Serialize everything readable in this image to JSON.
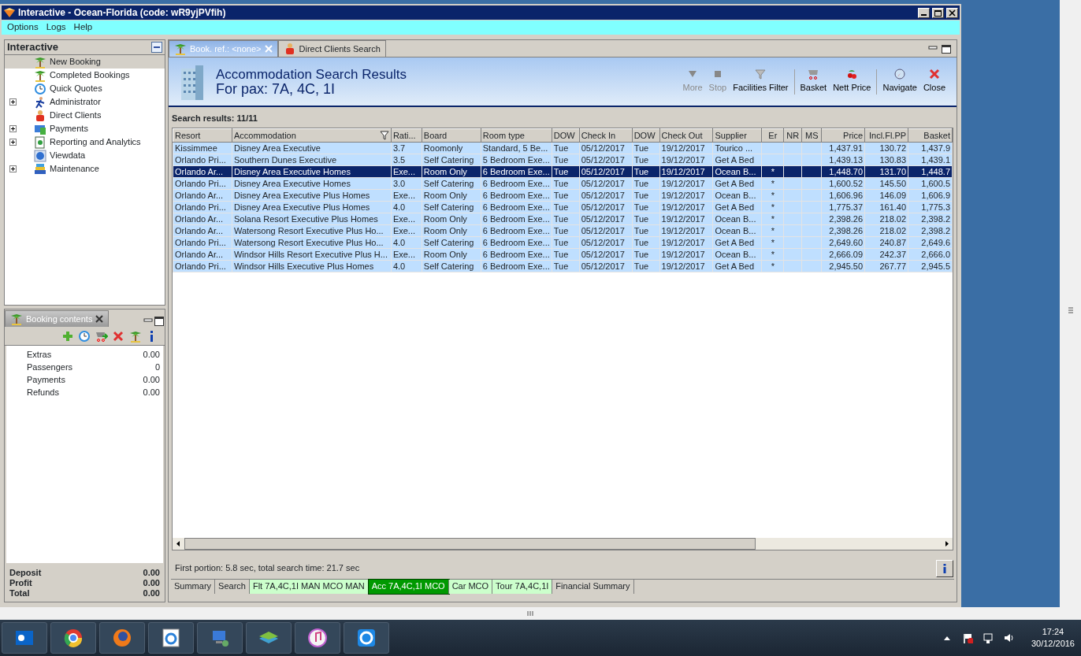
{
  "window": {
    "title": "Interactive - Ocean-Florida (code: wR9yjPVfih)"
  },
  "menu": [
    "Options",
    "Logs",
    "Help"
  ],
  "navigator": {
    "title": "Interactive",
    "items": [
      {
        "label": "New Booking",
        "selected": true,
        "expandable": false
      },
      {
        "label": "Completed Bookings",
        "selected": false,
        "expandable": false
      },
      {
        "label": "Quick Quotes",
        "selected": false,
        "expandable": false
      },
      {
        "label": "Administrator",
        "selected": false,
        "expandable": true
      },
      {
        "label": "Direct Clients",
        "selected": false,
        "expandable": false
      },
      {
        "label": "Payments",
        "selected": false,
        "expandable": true
      },
      {
        "label": "Reporting and Analytics",
        "selected": false,
        "expandable": true
      },
      {
        "label": "Viewdata",
        "selected": false,
        "expandable": false
      },
      {
        "label": "Maintenance",
        "selected": false,
        "expandable": true
      }
    ]
  },
  "booking_contents": {
    "tab": "Booking contents",
    "items": [
      {
        "label": "Extras",
        "value": "0.00"
      },
      {
        "label": "Passengers",
        "value": "0"
      },
      {
        "label": "Payments",
        "value": "0.00"
      },
      {
        "label": "Refunds",
        "value": "0.00"
      }
    ],
    "totals": [
      {
        "label": "Deposit",
        "value": "0.00"
      },
      {
        "label": "Profit",
        "value": "0.00"
      },
      {
        "label": "Total",
        "value": "0.00"
      }
    ]
  },
  "editor_tabs": [
    {
      "label": "Book. ref.: <none>",
      "selected": true,
      "closable": true
    },
    {
      "label": "Direct Clients Search",
      "selected": false,
      "closable": false
    }
  ],
  "header": {
    "title": "Accommodation Search Results",
    "subtitle": "For pax: 7A, 4C, 1I"
  },
  "toolbar": [
    [
      {
        "label": "More",
        "disabled": true
      },
      {
        "label": "Stop",
        "disabled": true
      },
      {
        "label": "Facilities Filter",
        "disabled": false
      }
    ],
    [
      {
        "label": "Basket",
        "disabled": false
      },
      {
        "label": "Nett Price",
        "disabled": false
      }
    ],
    [
      {
        "label": "Navigate",
        "disabled": false
      },
      {
        "label": "Close",
        "disabled": false
      }
    ]
  ],
  "results_label": "Search results: 11/11",
  "table": {
    "columns": [
      {
        "label": "Resort",
        "filter": false,
        "kind": "text"
      },
      {
        "label": "Accommodation",
        "filter": true,
        "kind": "text"
      },
      {
        "label": "Rati...",
        "filter": false,
        "kind": "text"
      },
      {
        "label": "Board",
        "filter": false,
        "kind": "text"
      },
      {
        "label": "Room type",
        "filter": false,
        "kind": "text"
      },
      {
        "label": "DOW",
        "filter": false,
        "kind": "text"
      },
      {
        "label": "Check In",
        "filter": false,
        "kind": "text"
      },
      {
        "label": "DOW",
        "filter": false,
        "kind": "text"
      },
      {
        "label": "Check Out",
        "filter": false,
        "kind": "text"
      },
      {
        "label": "Supplier",
        "filter": false,
        "kind": "text"
      },
      {
        "label": "Er",
        "filter": false,
        "kind": "flag"
      },
      {
        "label": "NR",
        "filter": false,
        "kind": "flag"
      },
      {
        "label": "MS",
        "filter": false,
        "kind": "flag"
      },
      {
        "label": "Price",
        "filter": false,
        "kind": "number"
      },
      {
        "label": "Incl.Fl.PP",
        "filter": false,
        "kind": "number"
      },
      {
        "label": "Basket",
        "filter": false,
        "kind": "number"
      }
    ],
    "rows": [
      {
        "selected": false,
        "cells": [
          "Kissimmee",
          "Disney Area Executive",
          "3.7",
          "Roomonly",
          "Standard, 5 Be...",
          "Tue",
          "05/12/2017",
          "Tue",
          "19/12/2017",
          "Tourico ...",
          null,
          null,
          null,
          "1,437.91",
          "130.72",
          "1,437.9"
        ]
      },
      {
        "selected": false,
        "cells": [
          "Orlando Pri...",
          "Southern Dunes Executive",
          "3.5",
          "Self Catering",
          "5 Bedroom Exe...",
          "Tue",
          "05/12/2017",
          "Tue",
          "19/12/2017",
          "Get A Bed",
          null,
          null,
          null,
          "1,439.13",
          "130.83",
          "1,439.1"
        ]
      },
      {
        "selected": true,
        "cells": [
          "Orlando Ar...",
          "Disney Area Executive Homes",
          "Exe...",
          "Room Only",
          "6 Bedroom Exe...",
          "Tue",
          "05/12/2017",
          "Tue",
          "19/12/2017",
          "Ocean B...",
          "*",
          null,
          null,
          "1,448.70",
          "131.70",
          "1,448.7"
        ]
      },
      {
        "selected": false,
        "cells": [
          "Orlando Pri...",
          "Disney Area Executive Homes",
          "3.0",
          "Self Catering",
          "6 Bedroom Exe...",
          "Tue",
          "05/12/2017",
          "Tue",
          "19/12/2017",
          "Get A Bed",
          "*",
          null,
          null,
          "1,600.52",
          "145.50",
          "1,600.5"
        ]
      },
      {
        "selected": false,
        "cells": [
          "Orlando Ar...",
          "Disney Area Executive Plus Homes",
          "Exe...",
          "Room Only",
          "6 Bedroom Exe...",
          "Tue",
          "05/12/2017",
          "Tue",
          "19/12/2017",
          "Ocean B...",
          "*",
          null,
          null,
          "1,606.96",
          "146.09",
          "1,606.9"
        ]
      },
      {
        "selected": false,
        "cells": [
          "Orlando Pri...",
          "Disney Area Executive Plus Homes",
          "4.0",
          "Self Catering",
          "6 Bedroom Exe...",
          "Tue",
          "05/12/2017",
          "Tue",
          "19/12/2017",
          "Get A Bed",
          "*",
          null,
          null,
          "1,775.37",
          "161.40",
          "1,775.3"
        ]
      },
      {
        "selected": false,
        "cells": [
          "Orlando Ar...",
          "Solana Resort Executive Plus Homes",
          "Exe...",
          "Room Only",
          "6 Bedroom Exe...",
          "Tue",
          "05/12/2017",
          "Tue",
          "19/12/2017",
          "Ocean B...",
          "*",
          null,
          null,
          "2,398.26",
          "218.02",
          "2,398.2"
        ]
      },
      {
        "selected": false,
        "cells": [
          "Orlando Ar...",
          "Watersong Resort Executive Plus Ho...",
          "Exe...",
          "Room Only",
          "6 Bedroom Exe...",
          "Tue",
          "05/12/2017",
          "Tue",
          "19/12/2017",
          "Ocean B...",
          "*",
          null,
          null,
          "2,398.26",
          "218.02",
          "2,398.2"
        ]
      },
      {
        "selected": false,
        "cells": [
          "Orlando Pri...",
          "Watersong Resort Executive Plus Ho...",
          "4.0",
          "Self Catering",
          "6 Bedroom Exe...",
          "Tue",
          "05/12/2017",
          "Tue",
          "19/12/2017",
          "Get A Bed",
          "*",
          null,
          null,
          "2,649.60",
          "240.87",
          "2,649.6"
        ]
      },
      {
        "selected": false,
        "cells": [
          "Orlando Ar...",
          "Windsor Hills Resort Executive Plus H...",
          "Exe...",
          "Room Only",
          "6 Bedroom Exe...",
          "Tue",
          "05/12/2017",
          "Tue",
          "19/12/2017",
          "Ocean B...",
          "*",
          null,
          null,
          "2,666.09",
          "242.37",
          "2,666.0"
        ]
      },
      {
        "selected": false,
        "cells": [
          "Orlando Pri...",
          "Windsor Hills Executive Plus Homes",
          "4.0",
          "Self Catering",
          "6 Bedroom Exe...",
          "Tue",
          "05/12/2017",
          "Tue",
          "19/12/2017",
          "Get A Bed",
          "*",
          null,
          null,
          "2,945.50",
          "267.77",
          "2,945.5"
        ]
      }
    ]
  },
  "status": "First portion: 5.8 sec, total search time: 21.7 sec",
  "bottom_tabs": [
    {
      "label": "Summary",
      "selected": false,
      "color": "#d4d0c8"
    },
    {
      "label": "Search",
      "selected": false,
      "color": "#d4d0c8"
    },
    {
      "label": "Flt 7A,4C,1I MAN MCO MAN",
      "selected": false,
      "color": "#ccffcc"
    },
    {
      "label": "Acc 7A,4C,1I MCO",
      "selected": true,
      "color": "#009900"
    },
    {
      "label": "Car MCO",
      "selected": false,
      "color": "#ccffcc"
    },
    {
      "label": "Tour 7A,4C,1I",
      "selected": false,
      "color": "#ccffcc"
    },
    {
      "label": "Financial Summary",
      "selected": false,
      "color": "#d4d0c8"
    }
  ],
  "taskbar": {
    "time": "17:24",
    "date": "30/12/2016"
  }
}
